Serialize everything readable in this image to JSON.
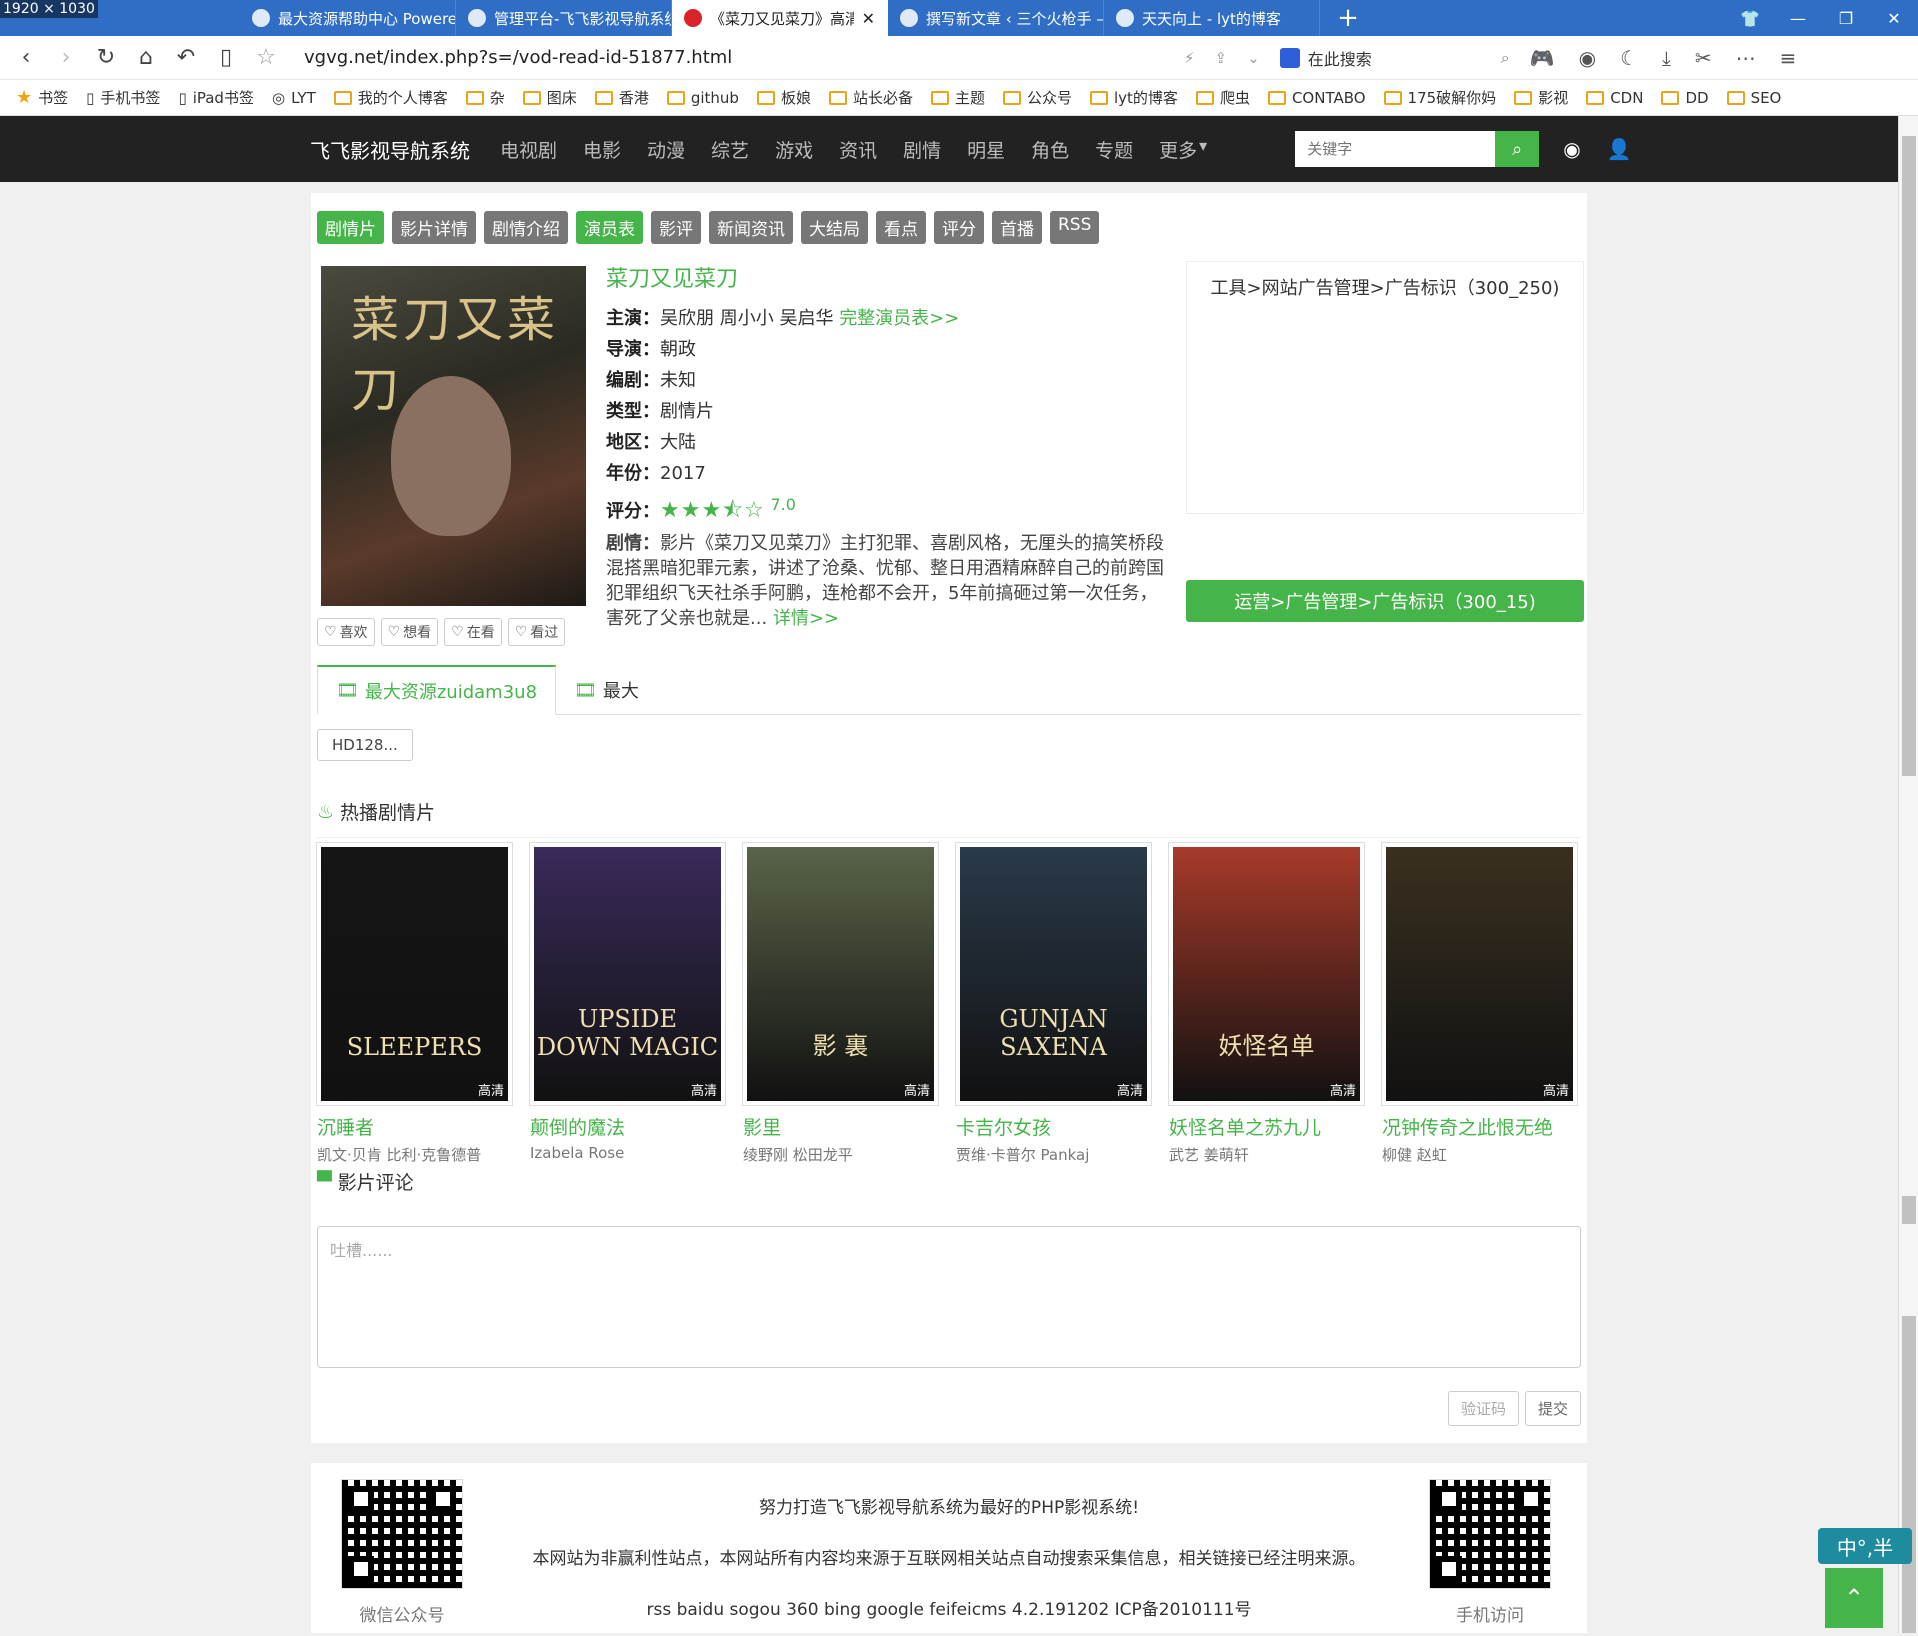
{
  "screen_resolution_label": "1920 × 1030",
  "browser": {
    "tabs": [
      {
        "title": "最大资源帮助中心 Powered b",
        "active": false
      },
      {
        "title": "管理平台-飞飞影视导航系统",
        "active": false
      },
      {
        "title": "《菜刀又见菜刀》高清在线观",
        "active": true
      },
      {
        "title": "撰写新文章 ‹ 三个火枪手 — W",
        "active": false
      },
      {
        "title": "天天向上 - lyt的博客",
        "active": false
      }
    ],
    "url": "vgvg.net/index.php?s=/vod-read-id-51877.html",
    "search_placeholder": "在此搜索",
    "bookmarks": [
      "书签",
      "手机书签",
      "iPad书签",
      "LYT",
      "我的个人博客",
      "杂",
      "图床",
      "香港",
      "github",
      "板娘",
      "站长必备",
      "主题",
      "公众号",
      "lyt的博客",
      "爬虫",
      "CONTABO",
      "175破解你妈",
      "影视",
      "CDN",
      "DD",
      "SEO"
    ]
  },
  "site": {
    "brand": "飞飞影视导航系统",
    "nav": [
      "电视剧",
      "电影",
      "动漫",
      "综艺",
      "游戏",
      "资讯",
      "剧情",
      "明星",
      "角色",
      "专题",
      "更多"
    ],
    "search_placeholder": "关键字"
  },
  "tags": [
    {
      "label": "剧情片",
      "green": true
    },
    {
      "label": "影片详情",
      "green": false
    },
    {
      "label": "剧情介绍",
      "green": false
    },
    {
      "label": "演员表",
      "green": true
    },
    {
      "label": "影评",
      "green": false
    },
    {
      "label": "新闻资讯",
      "green": false
    },
    {
      "label": "大结局",
      "green": false
    },
    {
      "label": "看点",
      "green": false
    },
    {
      "label": "评分",
      "green": false
    },
    {
      "label": "首播",
      "green": false
    },
    {
      "label": "RSS",
      "green": false
    }
  ],
  "movie": {
    "poster_text": "菜刀又菜刀",
    "title": "菜刀又见菜刀",
    "cast_label": "主演：",
    "cast": "吴欣朋 周小小 吴启华",
    "cast_more": "完整演员表>>",
    "director_label": "导演：",
    "director": "朝政",
    "writer_label": "编剧：",
    "writer": "未知",
    "genre_label": "类型：",
    "genre": "剧情片",
    "region_label": "地区：",
    "region": "大陆",
    "year_label": "年份：",
    "year": "2017",
    "rating_label": "评分：",
    "rating": "7.0",
    "stars": "★★★⯪☆",
    "plot_label": "剧情：",
    "plot": "影片《菜刀又见菜刀》主打犯罪、喜剧风格，无厘头的搞笑桥段混搭黑暗犯罪元素，讲述了沧桑、忧郁、整日用酒精麻醉自己的前跨国犯罪组织飞天社杀手阿鹏，连枪都不会开，5年前搞砸过第一次任务，害死了父亲也就是...",
    "plot_more": "详情>>",
    "actions": [
      "喜欢",
      "想看",
      "在看",
      "看过"
    ]
  },
  "ads": {
    "box": "工具>网站广告管理>广告标识（300_250)",
    "bar": "运营>广告管理>广告标识（300_15)"
  },
  "sources": {
    "tabs": [
      "最大资源zuidam3u8",
      "最大"
    ],
    "episode": "HD128..."
  },
  "hot": {
    "title": "热播剧情片",
    "hd_badge": "高清",
    "items": [
      {
        "name": "沉睡者",
        "cast": "凯文·贝肯 比利·克鲁德普",
        "poster_text": "SLEEPERS",
        "color": "#151515"
      },
      {
        "name": "颠倒的魔法",
        "cast": "Izabela Rose",
        "poster_text": "UPSIDE DOWN MAGIC",
        "color": "#3a2a5a"
      },
      {
        "name": "影里",
        "cast": "绫野刚 松田龙平",
        "poster_text": "影 裏",
        "color": "#5a6448"
      },
      {
        "name": "卡吉尔女孩",
        "cast": "贾维·卡普尔 Pankaj",
        "poster_text": "GUNJAN SAXENA",
        "color": "#2a3a4a"
      },
      {
        "name": "妖怪名单之苏九儿",
        "cast": "武艺 姜萌轩",
        "poster_text": "妖怪名单",
        "color": "#a83a2a"
      },
      {
        "name": "况钟传奇之此恨无绝",
        "cast": "柳健 赵虹",
        "poster_text": "",
        "color": "#3a3020"
      }
    ]
  },
  "comments": {
    "title": "影片评论",
    "placeholder": "吐槽......",
    "captcha": "验证码",
    "submit": "提交"
  },
  "footer": {
    "line1": "努力打造飞飞影视导航系统为最好的PHP影视系统!",
    "line2": "本网站为非赢利性站点，本网站所有内容均来源于互联网相关站点自动搜索采集信息，相关链接已经注明来源。",
    "line3": "rss baidu sogou 360 bing google feifeicms 4.2.191202 ICP备2010111号",
    "qr_left_label": "微信公众号",
    "qr_right_label": "手机访问"
  },
  "ime": "中°,半"
}
